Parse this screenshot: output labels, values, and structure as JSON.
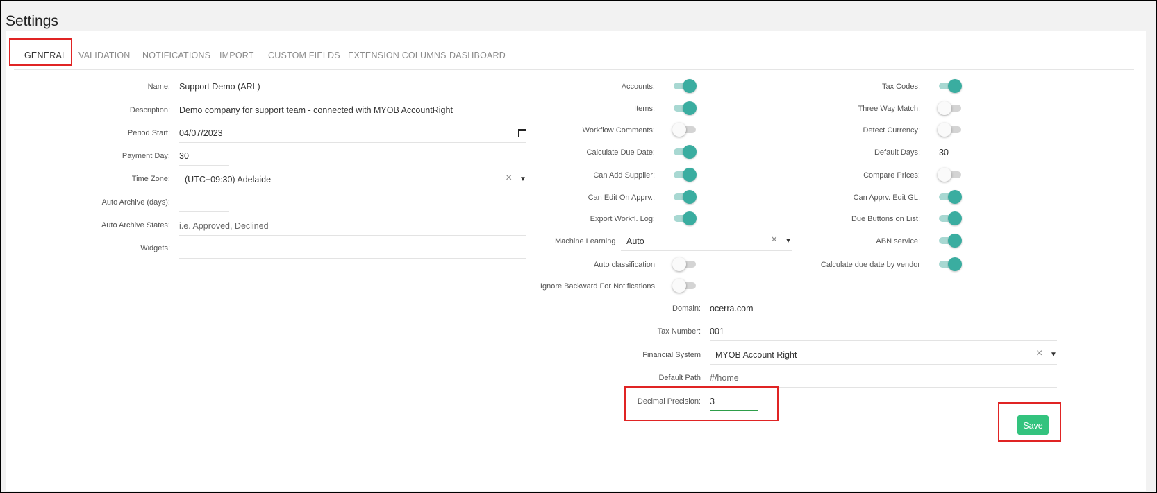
{
  "page": {
    "title": "Settings"
  },
  "tabs": [
    {
      "label": "GENERAL",
      "active": true
    },
    {
      "label": "VALIDATION",
      "active": false
    },
    {
      "label": "NOTIFICATIONS",
      "active": false
    },
    {
      "label": "IMPORT",
      "active": false
    },
    {
      "label": "CUSTOM FIELDS",
      "active": false
    },
    {
      "label": "EXTENSION COLUMNS",
      "active": false
    },
    {
      "label": "DASHBOARD",
      "active": false
    }
  ],
  "general": {
    "name": {
      "label": "Name:",
      "value": "Support Demo (ARL)"
    },
    "description": {
      "label": "Description:",
      "value": "Demo company for support team - connected with MYOB AccountRight"
    },
    "period_start": {
      "label": "Period Start:",
      "value": "04/07/2023"
    },
    "payment_day": {
      "label": "Payment Day:",
      "value": "30"
    },
    "time_zone": {
      "label": "Time Zone:",
      "value": "(UTC+09:30) Adelaide"
    },
    "auto_archive_days": {
      "label": "Auto Archive (days):",
      "value": ""
    },
    "auto_archive_states": {
      "label": "Auto Archive States:",
      "placeholder": "i.e. Approved, Declined"
    },
    "widgets": {
      "label": "Widgets:",
      "value": ""
    }
  },
  "features": {
    "accounts": {
      "label": "Accounts:",
      "on": true
    },
    "items": {
      "label": "Items:",
      "on": true
    },
    "workflow_comments": {
      "label": "Workflow Comments:",
      "on": false
    },
    "calculate_due_date": {
      "label": "Calculate Due Date:",
      "on": true
    },
    "can_add_supplier": {
      "label": "Can Add Supplier:",
      "on": true
    },
    "can_edit_on_apprv": {
      "label": "Can Edit On Apprv.:",
      "on": true
    },
    "export_workfl_log": {
      "label": "Export Workfl. Log:",
      "on": true
    },
    "machine_learning": {
      "label": "Machine Learning",
      "value": "Auto"
    },
    "auto_classification": {
      "label": "Auto classification",
      "on": false
    },
    "ignore_backward": {
      "label": "Ignore Backward For Notifications",
      "on": false
    }
  },
  "options": {
    "tax_codes": {
      "label": "Tax Codes:",
      "on": true
    },
    "three_way_match": {
      "label": "Three Way Match:",
      "on": false
    },
    "detect_currency": {
      "label": "Detect Currency:",
      "on": false
    },
    "default_days": {
      "label": "Default Days:",
      "value": "30"
    },
    "compare_prices": {
      "label": "Compare Prices:",
      "on": false
    },
    "can_apprv_edit_gl": {
      "label": "Can Apprv. Edit GL:",
      "on": true
    },
    "due_buttons_on_list": {
      "label": "Due Buttons on List:",
      "on": true
    },
    "abn_service": {
      "label": "ABN service:",
      "on": true
    },
    "calc_due_by_vendor": {
      "label": "Calculate due date by vendor",
      "on": true
    }
  },
  "system": {
    "domain": {
      "label": "Domain:",
      "value": "ocerra.com"
    },
    "tax_number": {
      "label": "Tax Number:",
      "value": "001"
    },
    "financial_system": {
      "label": "Financial System",
      "value": "MYOB Account Right"
    },
    "default_path": {
      "label": "Default Path",
      "value": "#/home"
    },
    "decimal_precision": {
      "label": "Decimal Precision:",
      "value": "3"
    }
  },
  "actions": {
    "save_label": "Save"
  },
  "icons": {
    "clear": "×",
    "caret": "▼",
    "calendar": "calendar-icon"
  },
  "colors": {
    "accent": "#3aada0",
    "save": "#33c37e",
    "highlight": "#e02424",
    "focus_underline": "#2e9e4a"
  }
}
